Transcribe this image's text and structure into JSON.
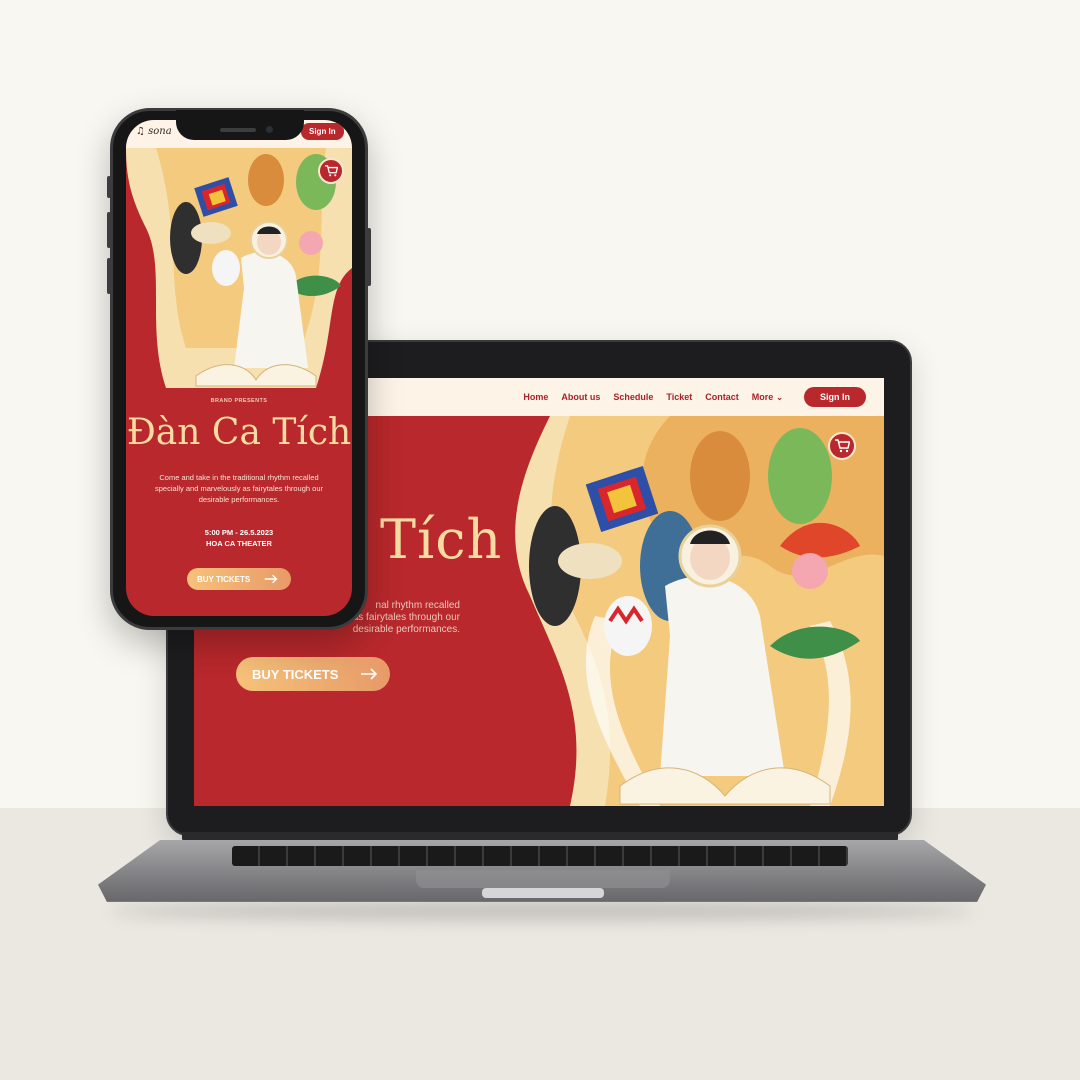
{
  "desktop": {
    "nav": {
      "items": [
        "Home",
        "About us",
        "Schedule",
        "Ticket",
        "Contact",
        "More"
      ],
      "signin": "Sign In"
    },
    "hero": {
      "title_partial": "Tích",
      "desc_partial": "nal rhythm recalled\nas fairytales through our\ndesirable performances.",
      "buy_label": "BUY TICKETS"
    }
  },
  "mobile": {
    "logo": "sona",
    "signin": "Sign In",
    "brand": "BRAND PRESENTS",
    "title": "Đàn Ca Tích",
    "description": "Come and take in the traditional rhythm recalled specially and marvelously as fairytales through our desirable performances.",
    "date": "5:00 PM - 26.5.2023",
    "venue": "HOA CA THEATER",
    "buy_label": "BUY TICKETS"
  },
  "icons": [
    "cart-icon",
    "arrow-right-icon",
    "chevron-down-icon",
    "music-note-icon"
  ],
  "colors": {
    "primary_red": "#b8282c",
    "cream": "#fdf3e7",
    "gold": "#f6dca2",
    "button_gradient_start": "#f6c27a",
    "button_gradient_end": "#e79a68"
  }
}
